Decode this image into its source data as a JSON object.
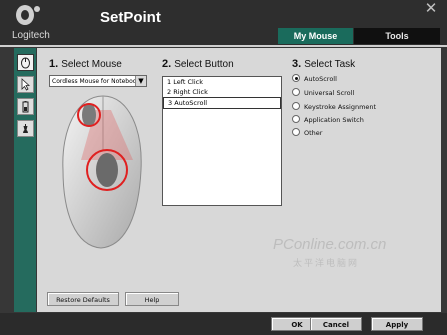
{
  "app": {
    "brand": "Logitech",
    "title": "SetPoint",
    "close_glyph": "✕"
  },
  "tabs": [
    {
      "label": "My Mouse"
    },
    {
      "label": "Tools"
    }
  ],
  "steps": {
    "select_mouse": {
      "num": "1.",
      "label": "Select Mouse",
      "value": "Cordless Mouse for Notebook"
    },
    "select_button": {
      "num": "2.",
      "label": "Select Button",
      "items": [
        "1  Left Click",
        "2  Right Click",
        "3  AutoScroll"
      ]
    },
    "select_task": {
      "num": "3.",
      "label": "Select Task",
      "options": [
        "AutoScroll",
        "Universal Scroll",
        "Keystroke Assignment",
        "Application Switch",
        "Other"
      ]
    }
  },
  "buttons": {
    "restore": "Restore Defaults",
    "help": "Help"
  },
  "footer": {
    "ok": "OK",
    "cancel": "Cancel",
    "apply": "Apply"
  },
  "watermark": {
    "line1": "PConline.com.cn",
    "line2": "太平洋电脑网"
  },
  "colors": {
    "accent": "#1a6b5c",
    "highlight": "#e02020"
  }
}
